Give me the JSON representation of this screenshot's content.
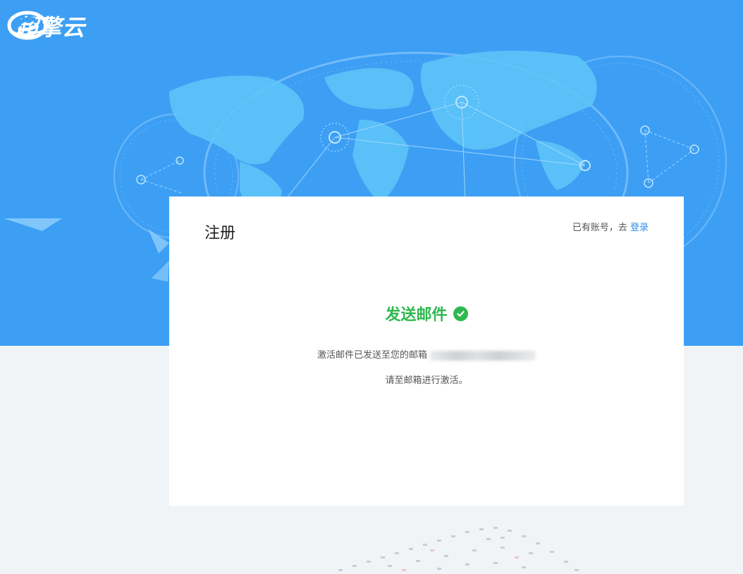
{
  "brand": {
    "name": "超擎云"
  },
  "card": {
    "title": "注册",
    "have_account_prefix": "已有账号，去",
    "login_link": "登录"
  },
  "result": {
    "title": "发送邮件",
    "line1": "激活邮件已发送至您的邮箱",
    "line2": "请至邮箱进行激活。"
  },
  "colors": {
    "hero_bg": "#3d9ff4",
    "success": "#2fb84f",
    "link": "#2d8cf0"
  }
}
